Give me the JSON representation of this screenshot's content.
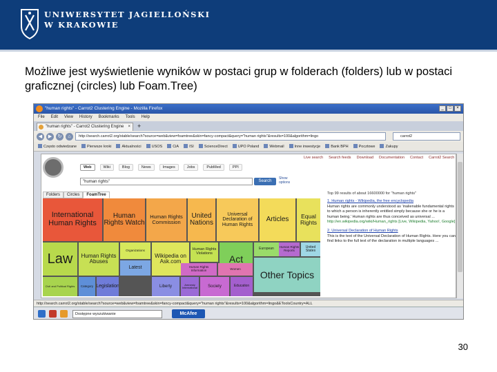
{
  "header": {
    "university_line1": "UNIWERSYTET JAGIELLOŃSKI",
    "university_line2": "W KRAKOWIE"
  },
  "slide": {
    "text": "Możliwe jest wyświetlenie wyników w postaci grup w folderach (folders) lub w postaci graficznej (circles) lub Foam.Tree)",
    "page_number": "30"
  },
  "browser": {
    "title": "\"human rights\" - Carrot2 Clustering Engine - Mozilla Firefox",
    "window_buttons": [
      "_",
      "□",
      "×"
    ],
    "menu": [
      "File",
      "Edit",
      "View",
      "History",
      "Bookmarks",
      "Tools",
      "Help"
    ],
    "tab_label": "\"human rights\" - Carrot2 Clustering Engine",
    "new_tab": "+",
    "url": "http://search.carrot2.org/stable/search?source=web&view=foamtree&skin=fancy-compact&query=\"human rights\"&results=100&algorithm=lingo",
    "search_placeholder": "carrot2",
    "bookmarks": [
      "Często odwiedzane",
      "Pierwsze kroki",
      "Aktualności",
      "USOS",
      "CiA",
      "ISI",
      "ScienceDirect",
      "UPO Poland",
      "Webmail",
      "Inne inwestycje",
      "Bank BPH",
      "Pocztowe",
      "Zakupy"
    ],
    "status": "http://search.carrot2.org/stable/search?source=web&view=foamtree&skin=fancy-compact&query=\"human rights\"&results=100&algorithm=lingo&EToolsCountry=ALL"
  },
  "carrot": {
    "top_links": [
      "Live search",
      "Search feeds",
      "Download",
      "Documentation",
      "Contact",
      "Carrot2 Search"
    ],
    "search_tabs": [
      "Web",
      "Wiki",
      "Blog",
      "News",
      "Images",
      "Jobs",
      "PubMed",
      "PPI"
    ],
    "query": "\"human rights\"",
    "search_button": "Search",
    "options_label": "Show options",
    "view_tabs": [
      "Folders",
      "Circles",
      "FoamTree"
    ],
    "cells": [
      {
        "label": "International Human Rights",
        "color": "#e8573a"
      },
      {
        "label": "Human Rights Watch",
        "color": "#f08a3c"
      },
      {
        "label": "Human Rights Commission",
        "color": "#f3a74a"
      },
      {
        "label": "United Nations",
        "color": "#f6b84e"
      },
      {
        "label": "Universal Declaration of Human Rights",
        "color": "#f7c95a"
      },
      {
        "label": "Articles",
        "color": "#f3db5a"
      },
      {
        "label": "Equal Rights",
        "color": "#e8e15c"
      },
      {
        "label": "Law",
        "color": "#b8d94c"
      },
      {
        "label": "Human Rights Abuses",
        "color": "#c7e054"
      },
      {
        "label": "Organizations",
        "color": "#d6e85c"
      },
      {
        "label": "Wikipedia on Ask.com",
        "color": "#dfe65c"
      },
      {
        "label": "Human Rights Violations",
        "color": "#c4e252"
      },
      {
        "label": "Act",
        "color": "#7fcf5a"
      },
      {
        "label": "European",
        "color": "#9adb6a"
      },
      {
        "label": "Other Topics",
        "color": "#8fd3c2"
      },
      {
        "label": "United States",
        "color": "#9fd7e5"
      },
      {
        "label": "Civil and Political Rights",
        "color": "#a8d44e"
      },
      {
        "label": "Latest",
        "color": "#7ca7e3"
      },
      {
        "label": "Liberty",
        "color": "#8a8ee3"
      },
      {
        "label": "Category",
        "color": "#5e8fd8"
      },
      {
        "label": "Legislation",
        "color": "#6f7cd9"
      },
      {
        "label": "Amnesty International",
        "color": "#9b6ad7"
      },
      {
        "label": "Society",
        "color": "#c86ad2"
      },
      {
        "label": "Education",
        "color": "#a45fce"
      },
      {
        "label": "Human Rights Information",
        "color": "#d06ac6"
      },
      {
        "label": "Human Rights Reports",
        "color": "#b56acf"
      },
      {
        "label": "Women",
        "color": "#e075b0"
      }
    ],
    "results_summary": "Top 99 results of about 16600000 for \"human rights\"",
    "results": [
      {
        "title": "1. Human rights - Wikipedia, the free encyclopedia",
        "desc": "Human rights are commonly understood as 'inalienable fundamental rights to which a person is inherently entitled simply because she or he is a human being.' Human rights are thus conceived as universal ...",
        "url": "http://en.wikipedia.org/wiki/Human_rights [Live, Wikipedia, Yahoo!, Google]"
      },
      {
        "title": "2. Universal Declaration of Human Rights",
        "desc": "This is the text of the Universal Declaration of Human Rights. Here you can find links to the full text of the declaration in multiple languages ..."
      }
    ]
  },
  "taskbar": {
    "search_text": "Dostępne wyszukiwanie",
    "mcafee": "McAfee"
  }
}
